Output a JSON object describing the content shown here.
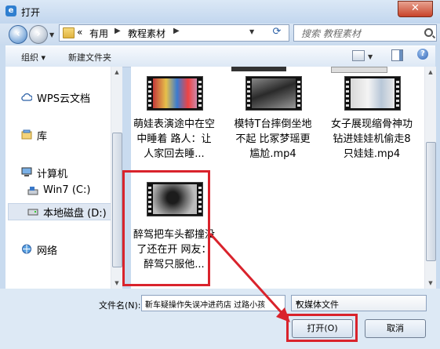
{
  "window": {
    "title": "打开",
    "app_icon": "e",
    "close_label": "✕"
  },
  "address": {
    "crumb_prefix": "«",
    "crumbs": [
      "有用",
      "教程素材"
    ],
    "refresh_label": "⟳",
    "search_placeholder": "搜索 教程素材"
  },
  "toolbar": {
    "organize_label": "组织 ▾",
    "new_folder_label": "新建文件夹",
    "help_label": "?"
  },
  "navpane": {
    "items": [
      {
        "label": "WPS云文档",
        "icon": "cloud-icon"
      },
      {
        "label": "库",
        "icon": "library-icon"
      },
      {
        "label": "计算机",
        "icon": "computer-icon"
      },
      {
        "label": "Win7 (C:)",
        "icon": "drive-icon"
      },
      {
        "label": "本地磁盘 (D:)",
        "icon": "drive-icon"
      },
      {
        "label": "网络",
        "icon": "network-icon"
      }
    ]
  },
  "files": [
    {
      "name": "萌娃表演途中在空中睡着 路人：让人家回去睡..."
    },
    {
      "name": "模特T台摔倒坐地不起 比冢梦瑶更尴尬.mp4"
    },
    {
      "name": "女子展现缩骨神功 钻进娃娃机偷走8只娃娃.mp4"
    },
    {
      "name": "醉驾把车头都撞没了还在开 网友：醉驾只服他..."
    }
  ],
  "bottom": {
    "filename_label": "文件名(N):",
    "filename_value": "靳车疑操作失误冲进药店 过路小孩",
    "filetype_value": "仅媒体文件",
    "open_label": "打开(O)",
    "cancel_label": "取消"
  },
  "colors": {
    "highlight": "#d9232c",
    "accent": "#2f63b4"
  }
}
